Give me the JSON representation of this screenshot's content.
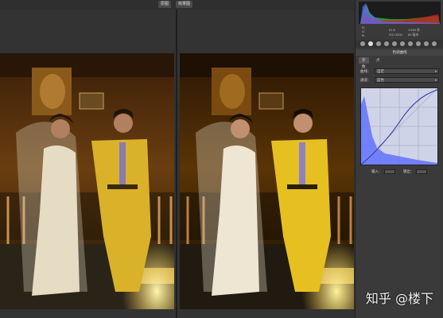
{
  "toolbar": {
    "before_label": "原图",
    "after_label": "效果图"
  },
  "panel": {
    "info": {
      "left_r": "R:",
      "left_g": "G:",
      "left_b": "B:",
      "aperture": "f/1.8",
      "shutter": "1/160 秒",
      "iso": "ISO 3200",
      "focal": "85 毫米"
    },
    "title": "色调曲线",
    "tabs": [
      "参数",
      "点"
    ],
    "curve_label": "曲线：",
    "curve_value": "自定",
    "channel_label": "通道：",
    "channel_value": "蓝色",
    "input_label": "输入：",
    "output_label": "输出："
  },
  "watermark": "知乎 @楼下",
  "colors": {
    "panel_bg": "#3a3a3a",
    "canvas_bg": "#333333",
    "curve_bg": "#cfd3e8",
    "histogram_blue": "#5a6bff"
  }
}
